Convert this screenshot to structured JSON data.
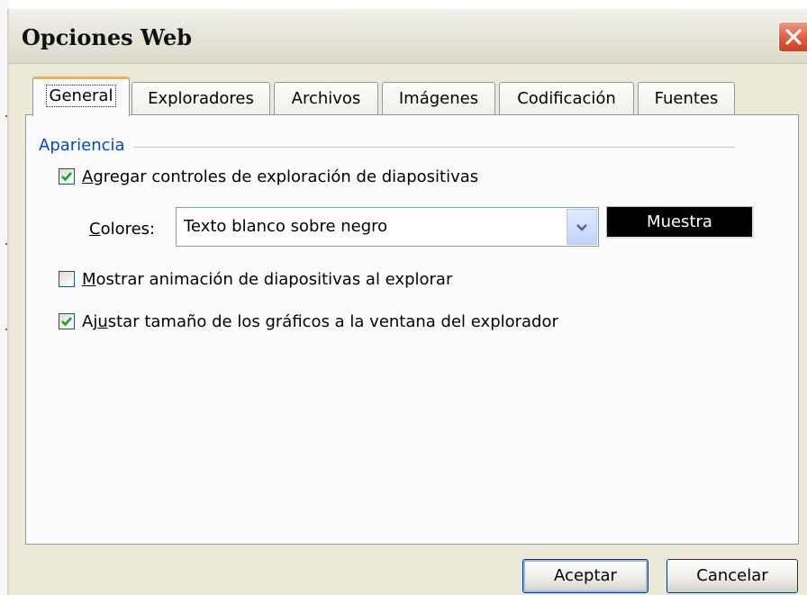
{
  "window": {
    "title": "Opciones Web"
  },
  "tabs": [
    {
      "label": "General",
      "active": true
    },
    {
      "label": "Exploradores"
    },
    {
      "label": "Archivos"
    },
    {
      "label": "Imágenes"
    },
    {
      "label": "Codificación"
    },
    {
      "label": "Fuentes"
    }
  ],
  "appearance": {
    "group_label": "Apariencia",
    "add_controls": {
      "accel": "A",
      "rest": "gregar controles de exploración de diapositivas",
      "checked": true
    },
    "colors": {
      "label_accel": "C",
      "label_rest": "olores:",
      "value": "Texto blanco sobre negro",
      "sample": "Muestra"
    },
    "show_animation": {
      "accel": "M",
      "rest": "ostrar animación de diapositivas al explorar",
      "checked": false
    },
    "resize_graphics": {
      "pre": "Aj",
      "accel": "u",
      "rest": "star tamaño de los gráficos a la ventana del explorador",
      "checked": true
    }
  },
  "buttons": {
    "ok": "Aceptar",
    "cancel": "Cancelar"
  },
  "colors": {
    "titlebar": "#e7e5d8",
    "panel": "#fcfcfe",
    "dialog": "#ece9d8",
    "accent": "#0046d5",
    "close": "#e25c3c",
    "check": "#21a121"
  },
  "icons": {
    "close": "close-icon",
    "check": "check-icon",
    "dropdown": "chevron-down-icon"
  }
}
